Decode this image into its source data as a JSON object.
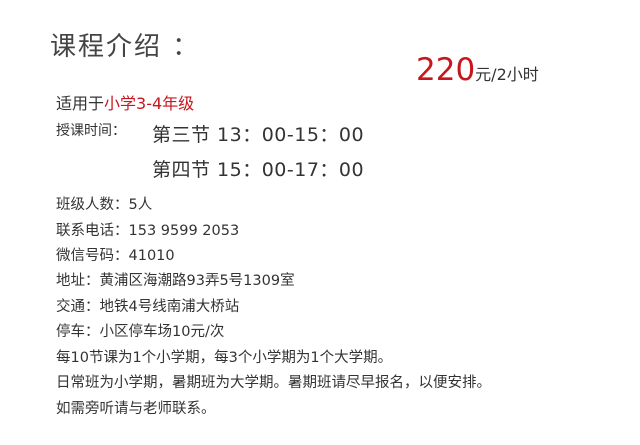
{
  "title": "课程介绍 ：",
  "price": {
    "amount": "220",
    "unit": "元/2小时"
  },
  "audience": {
    "prefix": "适用于",
    "grade": "小学3-4年级"
  },
  "schedule": {
    "label": "授课时间：",
    "slots": [
      "第三节 13：00-15：00",
      "第四节 15：00-17：00"
    ]
  },
  "info": {
    "class_size": "班级人数：5人",
    "phone": "联系电话：153 9599 2053",
    "wechat": "微信号码：41010",
    "address": "地址：黄浦区海潮路93弄5号1309室",
    "transport": "交通：地铁4号线南浦大桥站",
    "parking": "停车：小区停车场10元/次"
  },
  "notes": [
    "每10节课为1个小学期，每3个小学期为1个大学期。",
    "日常班为小学期，暑期班为大学期。暑期班请尽早报名，以便安排。",
    "如需旁听请与老师联系。"
  ]
}
